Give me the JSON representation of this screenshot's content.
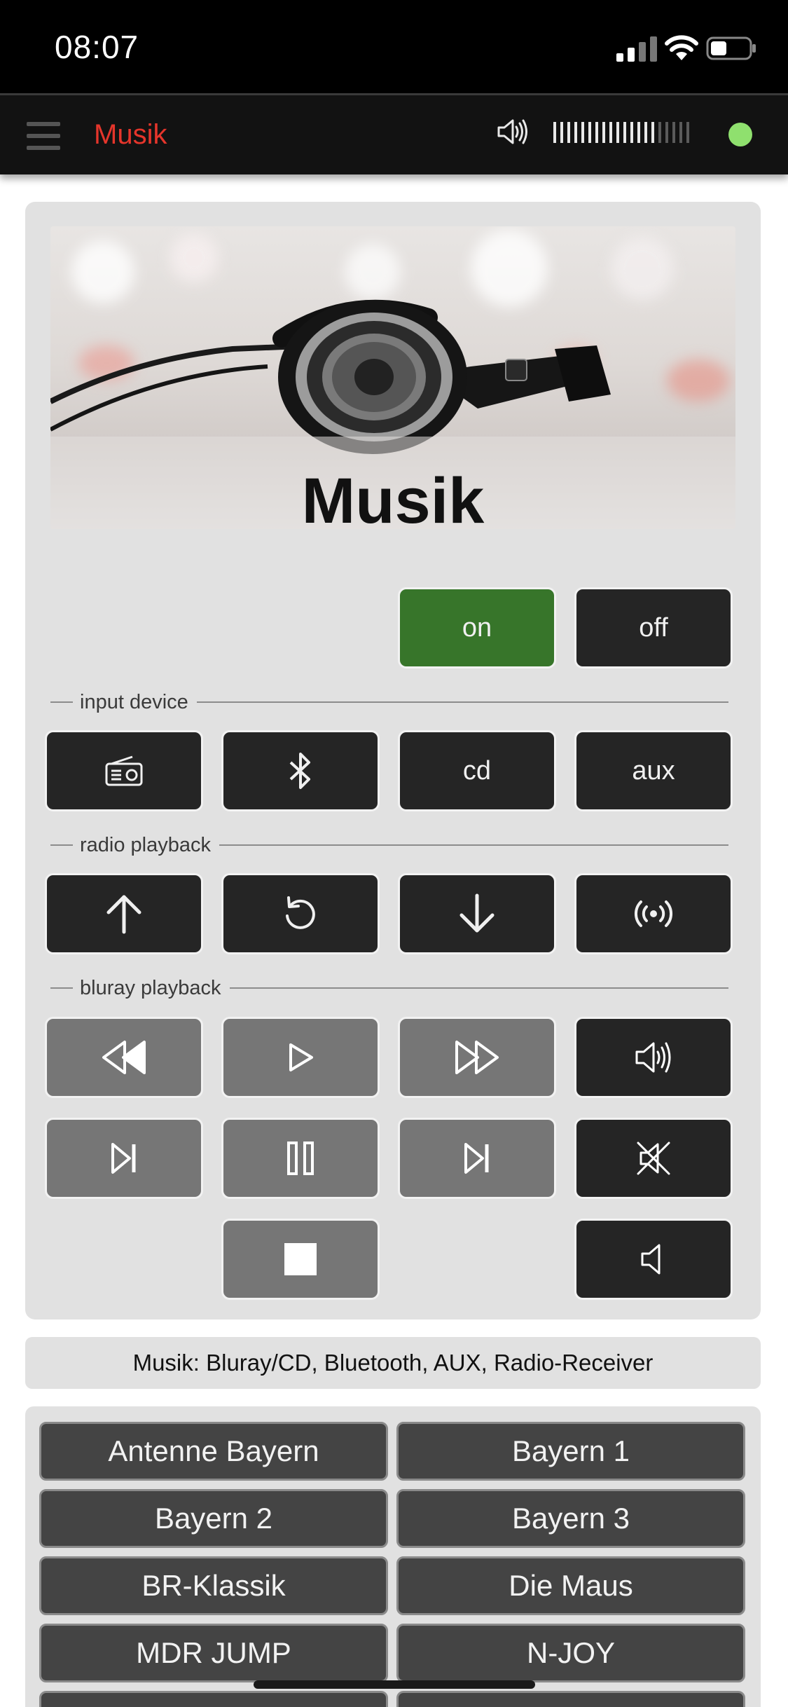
{
  "status_bar": {
    "time": "08:07"
  },
  "app_bar": {
    "title": "Musik",
    "volume_icon": "speaker-volume-icon",
    "volume_level_fraction": 0.75,
    "status_color": "#8fe06e"
  },
  "hero": {
    "title": "Musik",
    "image": "headphones-photo"
  },
  "power": {
    "on_label": "on",
    "off_label": "off",
    "on_color": "#37752a"
  },
  "sections": {
    "input_device": "input device",
    "radio_playback": "radio playback",
    "bluray_playback": "bluray playback"
  },
  "input_buttons": {
    "radio_icon": "radio-icon",
    "bluetooth_icon": "bluetooth-icon",
    "cd_label": "cd",
    "aux_label": "aux"
  },
  "radio_buttons": [
    "arrow-up-icon",
    "refresh-icon",
    "arrow-down-icon",
    "broadcast-icon"
  ],
  "bluray_buttons": [
    "rewind-icon",
    "play-icon",
    "fast-forward-icon",
    "volume-up-icon",
    "skip-back-icon",
    "pause-icon",
    "skip-forward-icon",
    "mute-icon",
    "stop-icon",
    "volume-down-icon"
  ],
  "caption": "Musik: Bluray/CD, Bluetooth, AUX, Radio-Receiver",
  "stations": [
    "Antenne Bayern",
    "Bayern 1",
    "Bayern 2",
    "Bayern 3",
    "BR-Klassik",
    "Die Maus",
    "MDR JUMP",
    "N-JOY",
    "",
    ""
  ],
  "colors": {
    "accent_red": "#e5352b",
    "button_dark": "#252525",
    "button_gray": "#767676",
    "panel": "#e1e1e1"
  }
}
